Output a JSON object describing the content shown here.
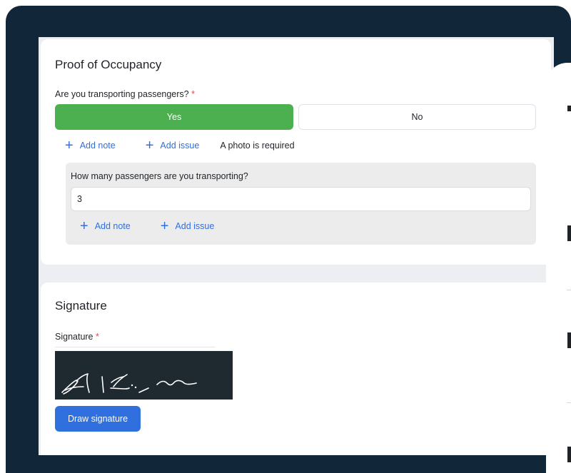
{
  "occupancy": {
    "title": "Proof of Occupancy",
    "question": "Are you transporting passengers?",
    "required_mark": "*",
    "yes_label": "Yes",
    "no_label": "No",
    "selected": "Yes",
    "add_note_label": "Add note",
    "add_issue_label": "Add issue",
    "photo_required_text": "A photo is required",
    "followup": {
      "question": "How many passengers are you transporting?",
      "value": "3",
      "add_note_label": "Add note",
      "add_issue_label": "Add issue"
    }
  },
  "signature": {
    "title": "Signature",
    "field_label": "Signature",
    "required_mark": "*",
    "draw_button_label": "Draw signature"
  },
  "colors": {
    "frame": "#12263a",
    "selected_green": "#4caf50",
    "link_blue": "#2f6fde",
    "required_red": "#e5484d"
  }
}
